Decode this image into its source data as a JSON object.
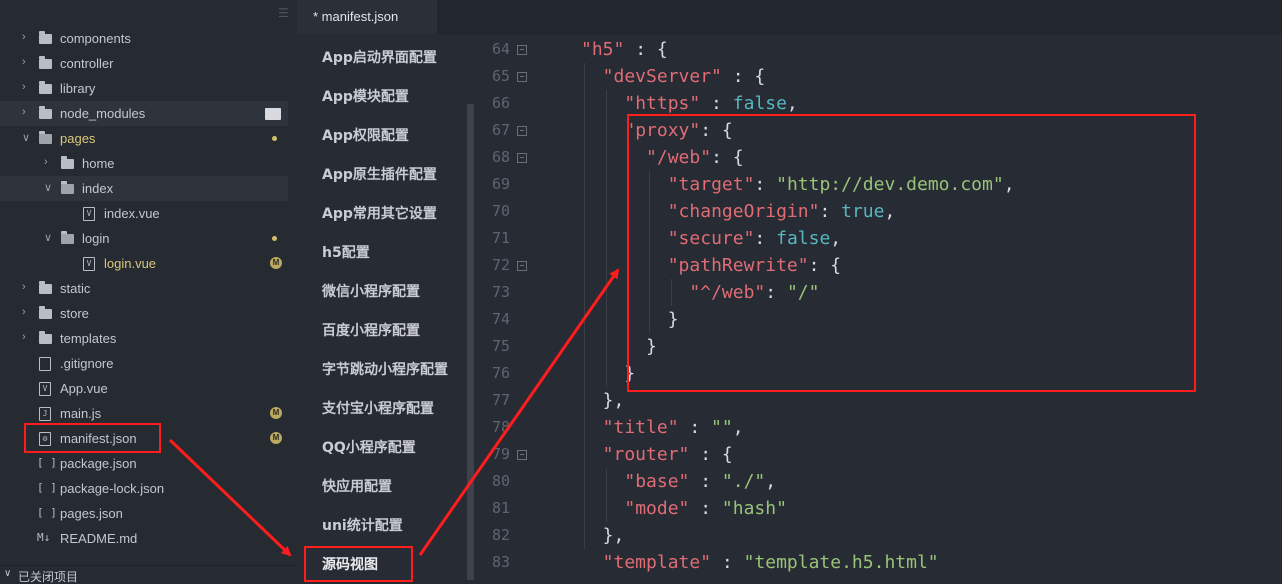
{
  "sidebar": {
    "items": [
      {
        "label": "components",
        "type": "folder"
      },
      {
        "label": "controller",
        "type": "folder"
      },
      {
        "label": "library",
        "type": "folder"
      },
      {
        "label": "node_modules",
        "type": "folder"
      },
      {
        "label": "pages",
        "type": "folder-open"
      },
      {
        "label": "home",
        "type": "folder"
      },
      {
        "label": "index",
        "type": "folder-open"
      },
      {
        "label": "index.vue",
        "type": "vue-file"
      },
      {
        "label": "login",
        "type": "folder-open"
      },
      {
        "label": "login.vue",
        "type": "vue-file",
        "badge": "M"
      },
      {
        "label": "static",
        "type": "folder"
      },
      {
        "label": "store",
        "type": "folder"
      },
      {
        "label": "templates",
        "type": "folder"
      },
      {
        "label": ".gitignore",
        "type": "file"
      },
      {
        "label": "App.vue",
        "type": "vue-file"
      },
      {
        "label": "main.js",
        "type": "js-file",
        "badge": "M"
      },
      {
        "label": "manifest.json",
        "type": "config-file",
        "badge": "M"
      },
      {
        "label": "package.json",
        "type": "json-file"
      },
      {
        "label": "package-lock.json",
        "type": "json-file"
      },
      {
        "label": "pages.json",
        "type": "json-file"
      },
      {
        "label": "README.md",
        "type": "md-file"
      }
    ],
    "footer_label": "已关闭项目"
  },
  "tab": {
    "label": "* manifest.json"
  },
  "config_nav": {
    "items": [
      "App启动界面配置",
      "App模块配置",
      "App权限配置",
      "App原生插件配置",
      "App常用其它设置",
      "h5配置",
      "微信小程序配置",
      "百度小程序配置",
      "字节跳动小程序配置",
      "支付宝小程序配置",
      "QQ小程序配置",
      "快应用配置",
      "uni统计配置",
      "源码视图"
    ],
    "selected": "源码视图"
  },
  "editor": {
    "line_numbers": [
      "64",
      "65",
      "66",
      "67",
      "68",
      "69",
      "70",
      "71",
      "72",
      "73",
      "74",
      "75",
      "76",
      "77",
      "78",
      "79",
      "80",
      "81",
      "82",
      "83"
    ],
    "fold_lines": [
      "64",
      "65",
      "67",
      "68",
      "72",
      "79"
    ],
    "lines": [
      [
        [
          "k",
          "\"h5\""
        ],
        [
          "p",
          " : {"
        ]
      ],
      [
        [
          "k",
          "\"devServer\""
        ],
        [
          "p",
          " : {"
        ]
      ],
      [
        [
          "k",
          "\"https\""
        ],
        [
          "p",
          " : "
        ],
        [
          "b",
          "false"
        ],
        [
          "p",
          ","
        ]
      ],
      [
        [
          "k",
          "\"proxy\""
        ],
        [
          "p",
          ": {"
        ]
      ],
      [
        [
          "k",
          "\"/web\""
        ],
        [
          "p",
          ": {"
        ]
      ],
      [
        [
          "k",
          "\"target\""
        ],
        [
          "p",
          ": "
        ],
        [
          "s",
          "\"http://dev.demo.com\""
        ],
        [
          "p",
          ","
        ]
      ],
      [
        [
          "k",
          "\"changeOrigin\""
        ],
        [
          "p",
          ": "
        ],
        [
          "b",
          "true"
        ],
        [
          "p",
          ","
        ]
      ],
      [
        [
          "k",
          "\"secure\""
        ],
        [
          "p",
          ": "
        ],
        [
          "b",
          "false"
        ],
        [
          "p",
          ","
        ]
      ],
      [
        [
          "k",
          "\"pathRewrite\""
        ],
        [
          "p",
          ": {"
        ]
      ],
      [
        [
          "k",
          "\"^/web\""
        ],
        [
          "p",
          ": "
        ],
        [
          "s",
          "\"/\""
        ]
      ],
      [
        [
          "p",
          "}"
        ]
      ],
      [
        [
          "p",
          "}"
        ]
      ],
      [
        [
          "p",
          "}"
        ]
      ],
      [
        [
          "p",
          "},"
        ]
      ],
      [
        [
          "k",
          "\"title\""
        ],
        [
          "p",
          " : "
        ],
        [
          "s",
          "\"\""
        ],
        [
          "p",
          ","
        ]
      ],
      [
        [
          "k",
          "\"router\""
        ],
        [
          "p",
          " : {"
        ]
      ],
      [
        [
          "k",
          "\"base\""
        ],
        [
          "p",
          " : "
        ],
        [
          "s",
          "\"./\""
        ],
        [
          "p",
          ","
        ]
      ],
      [
        [
          "k",
          "\"mode\""
        ],
        [
          "p",
          " : "
        ],
        [
          "s",
          "\"hash\""
        ]
      ],
      [
        [
          "p",
          "},"
        ]
      ],
      [
        [
          "k",
          "\"template\""
        ],
        [
          "p",
          " : "
        ],
        [
          "s",
          "\"template.h5.html\""
        ]
      ]
    ]
  },
  "colors": {
    "annotation_red": "#ff1c1c",
    "json_key": "#e06c75",
    "json_string": "#98c379",
    "json_boolean": "#56b6c2"
  }
}
